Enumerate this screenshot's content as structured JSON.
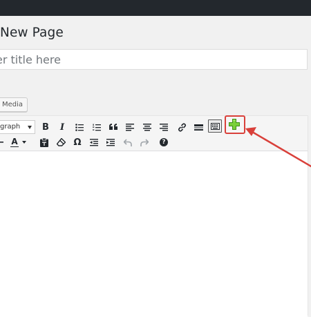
{
  "page": {
    "heading": "New Page"
  },
  "title_field": {
    "placeholder": "er title here",
    "value": ""
  },
  "media": {
    "add_media_label": "d Media"
  },
  "toolbar": {
    "format_select": "graph",
    "row1": [
      "bold-icon",
      "italic-icon",
      "bullet-list-icon",
      "numbered-list-icon",
      "blockquote-icon",
      "align-left-icon",
      "align-center-icon",
      "align-right-icon",
      "link-icon",
      "read-more-icon",
      "toolbar-toggle-icon",
      "add-shortcode-icon"
    ],
    "row2": [
      "horizontal-line-icon",
      "text-color-icon",
      "paste-as-text-icon",
      "clear-formatting-icon",
      "special-character-icon",
      "outdent-icon",
      "indent-icon",
      "undo-icon",
      "redo-icon",
      "help-icon"
    ],
    "bold_glyph": "B",
    "italic_glyph": "I",
    "text_color_glyph": "A",
    "omega_glyph": "Ω",
    "help_glyph": "?"
  },
  "colors": {
    "admin_bar": "#23282d",
    "highlight": "#d9403a",
    "plus": "#7ad03a"
  }
}
